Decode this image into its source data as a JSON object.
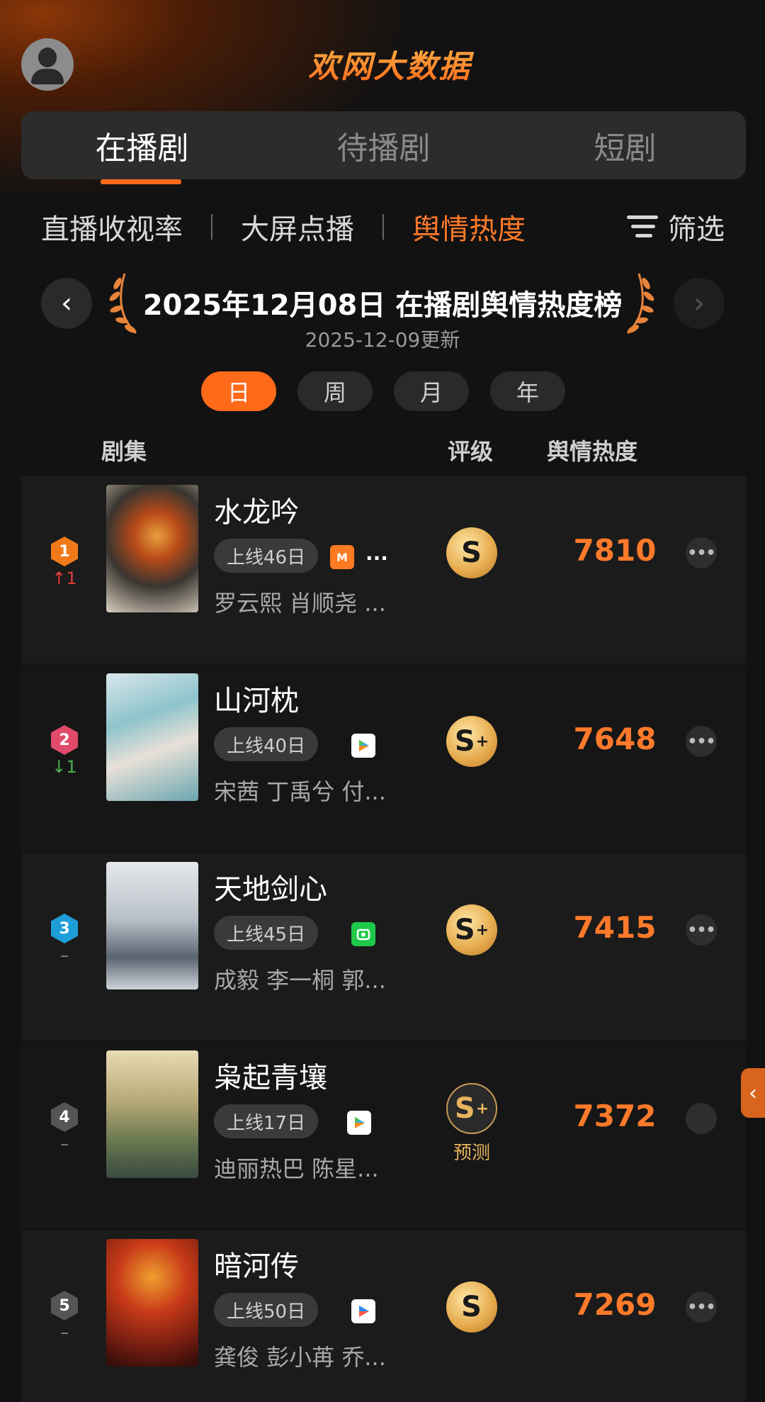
{
  "header": {
    "logo": "欢网大数据"
  },
  "main_tabs": [
    {
      "label": "在播剧",
      "active": true
    },
    {
      "label": "待播剧",
      "active": false
    },
    {
      "label": "短剧",
      "active": false
    }
  ],
  "sub_tabs": [
    {
      "label": "直播收视率",
      "active": false
    },
    {
      "label": "大屏点播",
      "active": false
    },
    {
      "label": "舆情热度",
      "active": true
    }
  ],
  "filter_label": "筛选",
  "ranking": {
    "title": "2025年12月08日 在播剧舆情热度榜",
    "updated": "2025-12-09更新"
  },
  "periods": [
    {
      "label": "日",
      "active": true
    },
    {
      "label": "周",
      "active": false
    },
    {
      "label": "月",
      "active": false
    },
    {
      "label": "年",
      "active": false
    }
  ],
  "columns": {
    "series": "剧集",
    "rating": "评级",
    "heat": "舆情热度"
  },
  "rows": [
    {
      "rank": "1",
      "change": "↑1",
      "title": "水龙吟",
      "online": "上线46日",
      "platforms": [
        "mango-tv-icon"
      ],
      "more": "...",
      "cast": "罗云熙 肖顺尧 ...",
      "grade": "S",
      "grade_plus": "",
      "heat": "7810",
      "predict": ""
    },
    {
      "rank": "2",
      "change": "↓1",
      "title": "山河枕",
      "online": "上线40日",
      "platforms": [
        "tencent-video-icon"
      ],
      "more": "",
      "cast": "宋茜 丁禹兮 付...",
      "grade": "S",
      "grade_plus": "+",
      "heat": "7648",
      "predict": ""
    },
    {
      "rank": "3",
      "change": "–",
      "title": "天地剑心",
      "online": "上线45日",
      "platforms": [
        "iqiyi-icon"
      ],
      "more": "",
      "cast": "成毅 李一桐 郭...",
      "grade": "S",
      "grade_plus": "+",
      "heat": "7415",
      "predict": ""
    },
    {
      "rank": "4",
      "change": "–",
      "title": "枭起青壤",
      "online": "上线17日",
      "platforms": [
        "tencent-video-icon"
      ],
      "more": "",
      "cast": "迪丽热巴 陈星...",
      "grade": "S",
      "grade_plus": "+",
      "heat": "7372",
      "predict": "预测"
    },
    {
      "rank": "5",
      "change": "–",
      "title": "暗河传",
      "online": "上线50日",
      "platforms": [
        "youku-icon"
      ],
      "more": "",
      "cast": "龚俊 彭小苒 乔...",
      "grade": "S",
      "grade_plus": "",
      "heat": "7269",
      "predict": ""
    }
  ],
  "colors": {
    "accent": "#ff6a1a",
    "heat": "#ff7a2a",
    "rank1": "#f07a1a",
    "rank2": "#e24a6a",
    "rank3": "#1e9ed8",
    "rank_other": "#555555",
    "up": "#e23a3a",
    "down": "#4caf50"
  }
}
